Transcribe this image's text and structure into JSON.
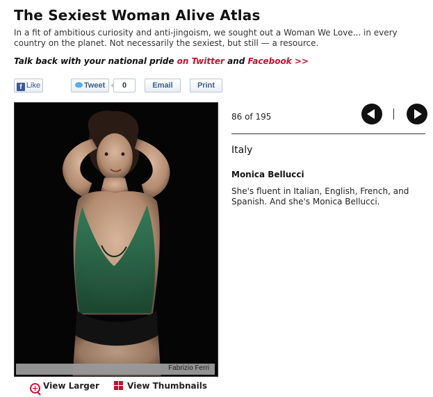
{
  "header": {
    "title": "The Sexiest Woman Alive Atlas",
    "intro": "In a fit of ambitious curiosity and anti-jingoism, we sought out a Woman We Love... in every country on the planet. Not necessarily the sexiest, but still — a resource.",
    "talkback_prefix": "Talk back with your national pride ",
    "talkback_twitter": "on Twitter",
    "talkback_and": " and ",
    "talkback_facebook": "Facebook >>"
  },
  "share": {
    "fb_like": "Like",
    "tweet": "Tweet",
    "tweet_count": "0",
    "email": "Email",
    "print": "Print"
  },
  "photo": {
    "credit": "Fabrizio Ferri",
    "view_larger": "View Larger",
    "view_thumbnails": "View Thumbnails"
  },
  "gallery": {
    "counter": "86 of 195",
    "country": "Italy",
    "name": "Monica Bellucci",
    "description": "She's fluent in Italian, English, French, and Spanish. And she's Monica Bellucci."
  },
  "colors": {
    "accent_red": "#c8102e",
    "photo_bg": "#000000",
    "top_green": "#1f5a3c"
  }
}
